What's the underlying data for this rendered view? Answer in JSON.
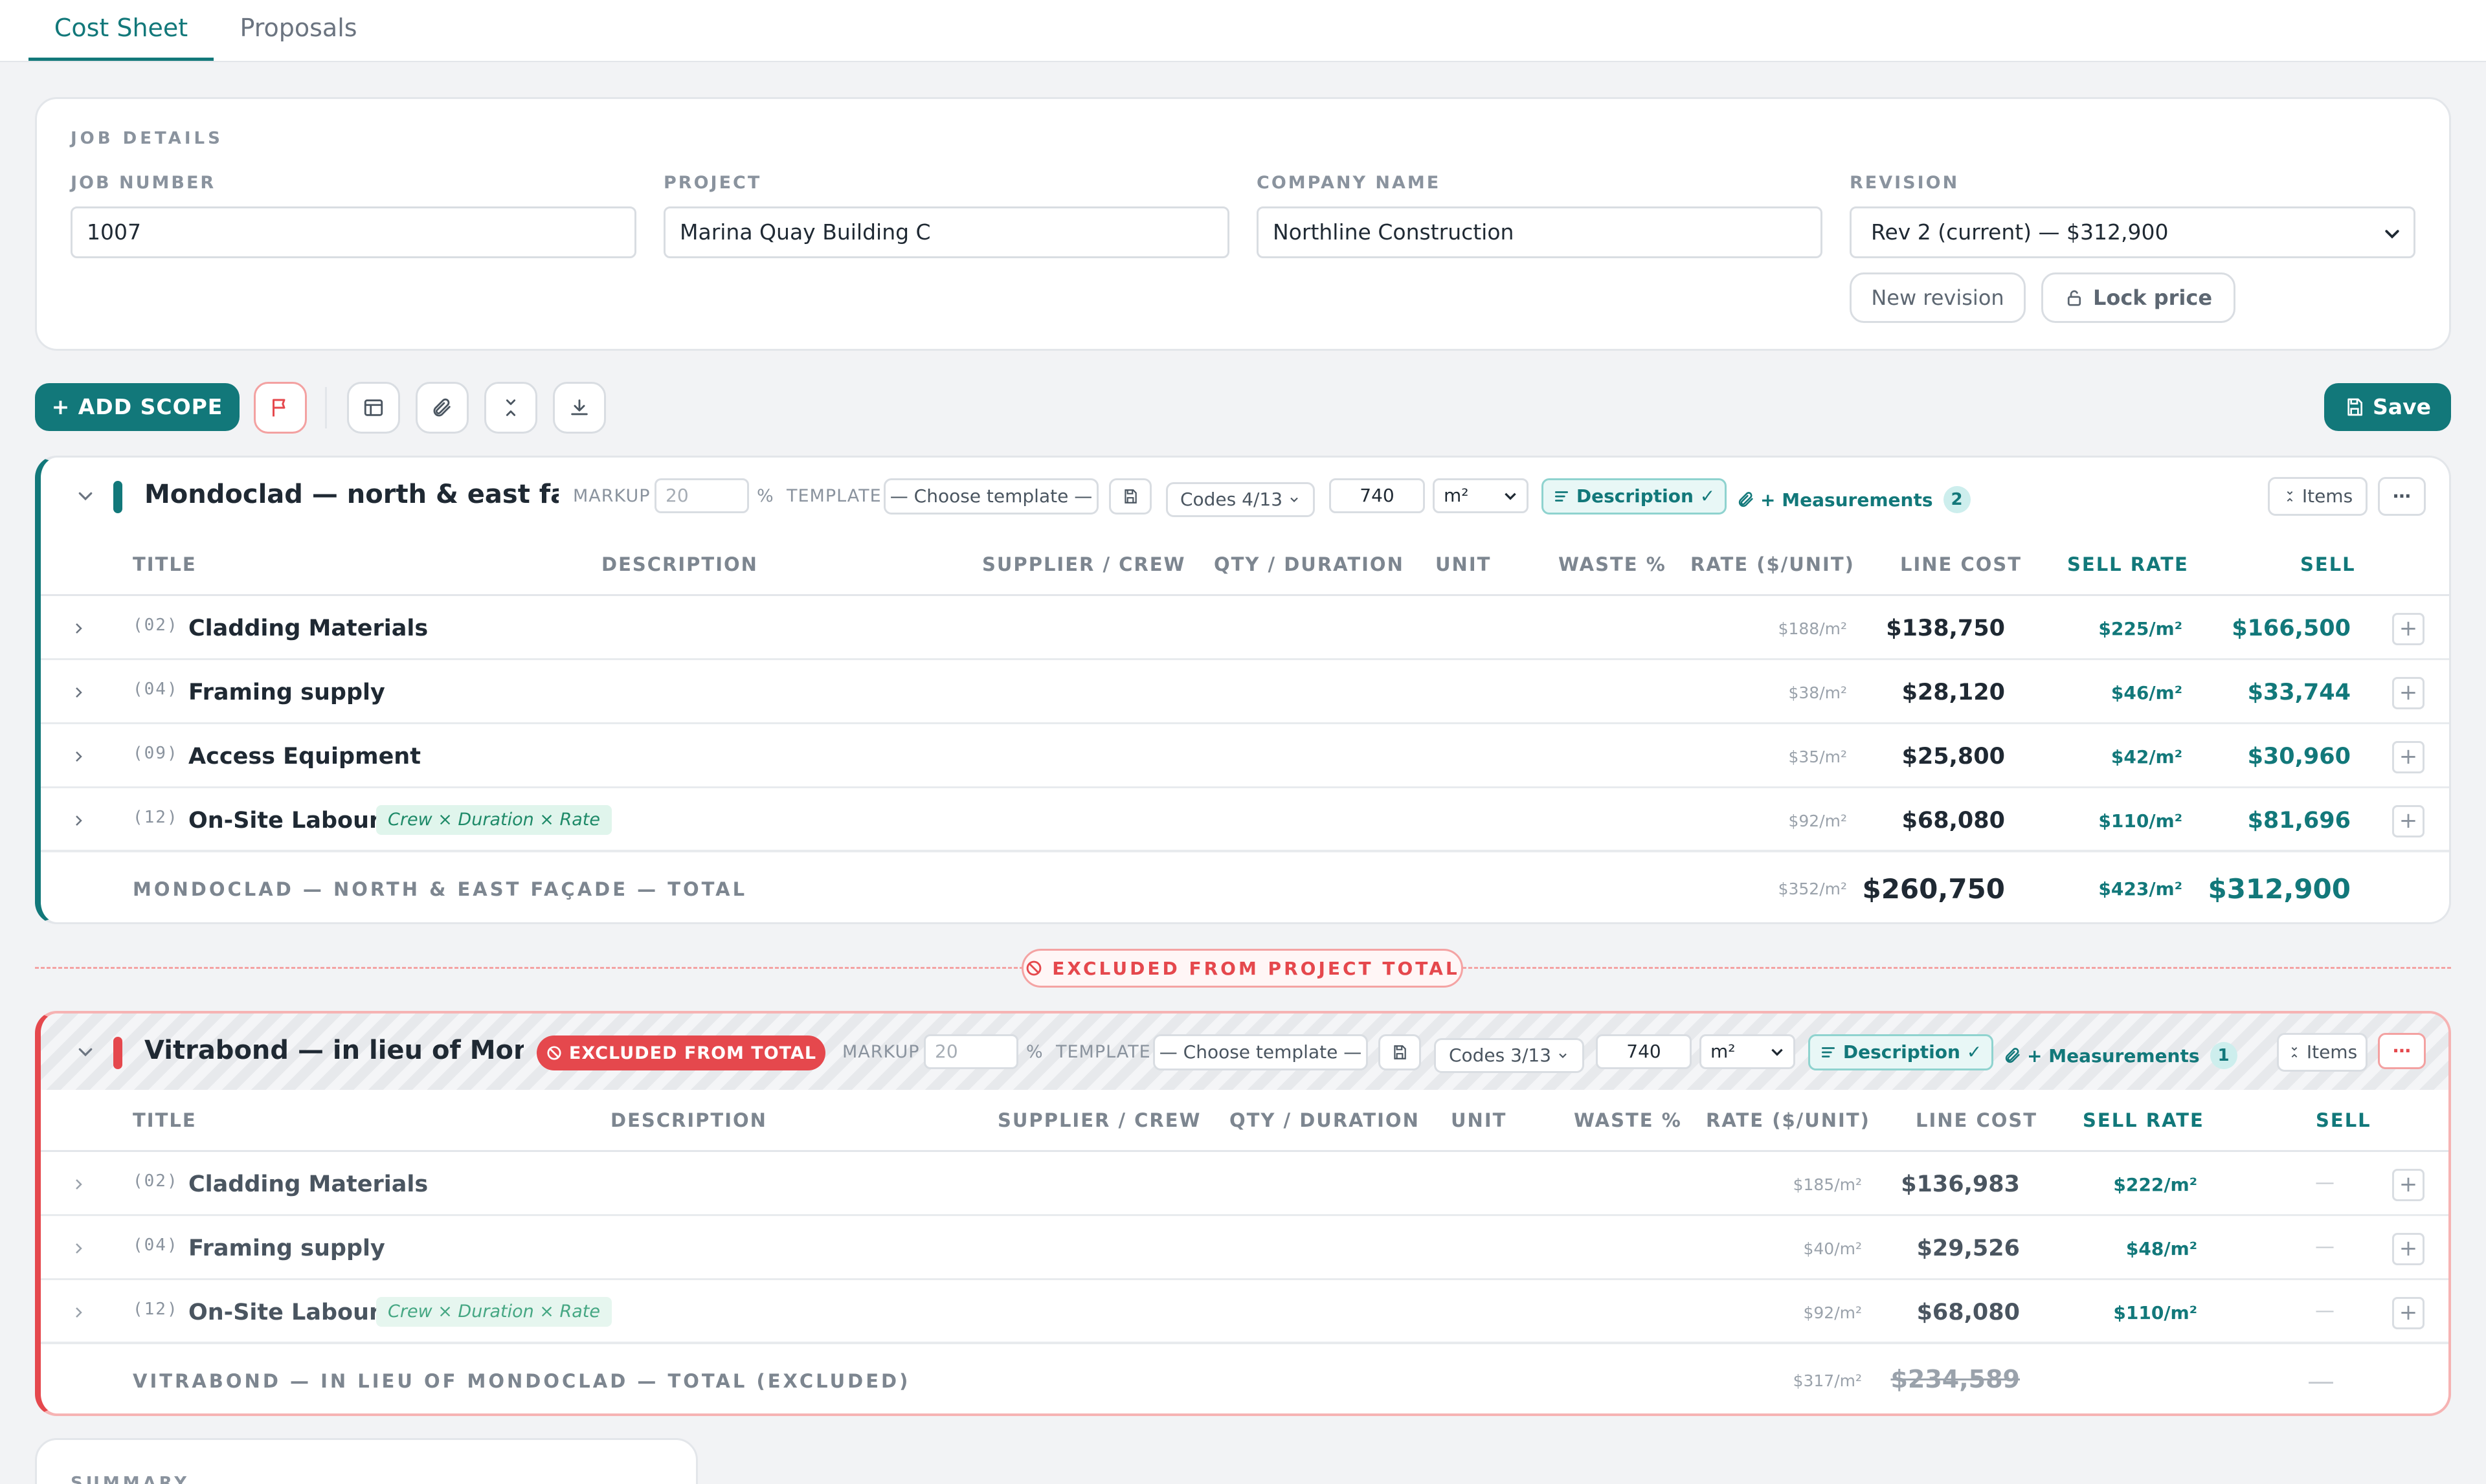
{
  "tabs": [
    {
      "label": "Cost Sheet",
      "active": true
    },
    {
      "label": "Proposals",
      "active": false
    }
  ],
  "job_details": {
    "section_title": "JOB DETAILS",
    "job_number": {
      "label": "JOB NUMBER",
      "value": "1007"
    },
    "project": {
      "label": "PROJECT",
      "value": "Marina Quay Building C"
    },
    "company_name": {
      "label": "COMPANY NAME",
      "value": "Northline Construction"
    },
    "revision": {
      "label": "REVISION",
      "value": "Rev 2 (current) — $312,900"
    },
    "new_revision_label": "New revision",
    "lock_price_label": "Lock price"
  },
  "toolbar": {
    "add_scope_label": "+ ADD SCOPE",
    "save_label": "Save"
  },
  "columns": [
    "TITLE",
    "DESCRIPTION",
    "SUPPLIER / CREW",
    "QTY / DURATION",
    "UNIT",
    "WASTE %",
    "RATE ($/UNIT)",
    "LINE COST",
    "SELL RATE",
    "SELL"
  ],
  "scope1": {
    "title": "Mondoclad — north & east façade",
    "markup_label": "MARKUP",
    "markup_value": "20",
    "percent": "%",
    "template_label": "TEMPLATE",
    "template_value": "— Choose template —",
    "codes_label": "Codes 4/13",
    "qty_value": "740",
    "unit_value": "m²",
    "description_label": "Description ✓",
    "measurements_label": "+ Measurements",
    "measurements_count": "2",
    "items_label": "Items",
    "rows": [
      {
        "code": "(02)",
        "title": "Cladding Materials",
        "tag": "",
        "rate": "$188/m²",
        "line_cost": "$138,750",
        "sell_rate": "$225/m²",
        "sell": "$166,500"
      },
      {
        "code": "(04)",
        "title": "Framing supply",
        "tag": "",
        "rate": "$38/m²",
        "line_cost": "$28,120",
        "sell_rate": "$46/m²",
        "sell": "$33,744"
      },
      {
        "code": "(09)",
        "title": "Access Equipment",
        "tag": "",
        "rate": "$35/m²",
        "line_cost": "$25,800",
        "sell_rate": "$42/m²",
        "sell": "$30,960"
      },
      {
        "code": "(12)",
        "title": "On-Site Labour",
        "tag": "Crew × Duration × Rate",
        "rate": "$92/m²",
        "line_cost": "$68,080",
        "sell_rate": "$110/m²",
        "sell": "$81,696"
      }
    ],
    "total": {
      "label": "MONDOCLAD — NORTH & EAST FAÇADE — TOTAL",
      "rate": "$352/m²",
      "line_cost": "$260,750",
      "sell_rate": "$423/m²",
      "sell": "$312,900"
    }
  },
  "excluded_divider_label": "EXCLUDED FROM PROJECT TOTAL",
  "scope2": {
    "title": "Vitrabond — in lieu of Mondoclad",
    "excluded_badge": "EXCLUDED FROM TOTAL",
    "markup_label": "MARKUP",
    "markup_value": "20",
    "percent": "%",
    "template_label": "TEMPLATE",
    "template_value": "— Choose template —",
    "codes_label": "Codes 3/13",
    "qty_value": "740",
    "unit_value": "m²",
    "description_label": "Description ✓",
    "measurements_label": "+ Measurements",
    "measurements_count": "1",
    "items_label": "Items",
    "rows": [
      {
        "code": "(02)",
        "title": "Cladding Materials",
        "tag": "",
        "rate": "$185/m²",
        "line_cost": "$136,983",
        "sell_rate": "$222/m²",
        "sell": "—"
      },
      {
        "code": "(04)",
        "title": "Framing supply",
        "tag": "",
        "rate": "$40/m²",
        "line_cost": "$29,526",
        "sell_rate": "$48/m²",
        "sell": "—"
      },
      {
        "code": "(12)",
        "title": "On-Site Labour",
        "tag": "Crew × Duration × Rate",
        "rate": "$92/m²",
        "line_cost": "$68,080",
        "sell_rate": "$110/m²",
        "sell": "—"
      }
    ],
    "total": {
      "label": "VITRABOND — IN LIEU OF MONDOCLAD — TOTAL (EXCLUDED)",
      "rate": "$317/m²",
      "line_cost": "$234,589",
      "sell": "—"
    }
  },
  "summary": {
    "section_title": "SUMMARY"
  },
  "colors": {
    "accent": "#12787a",
    "danger": "#e5484d",
    "background": "#f2f3f5"
  }
}
